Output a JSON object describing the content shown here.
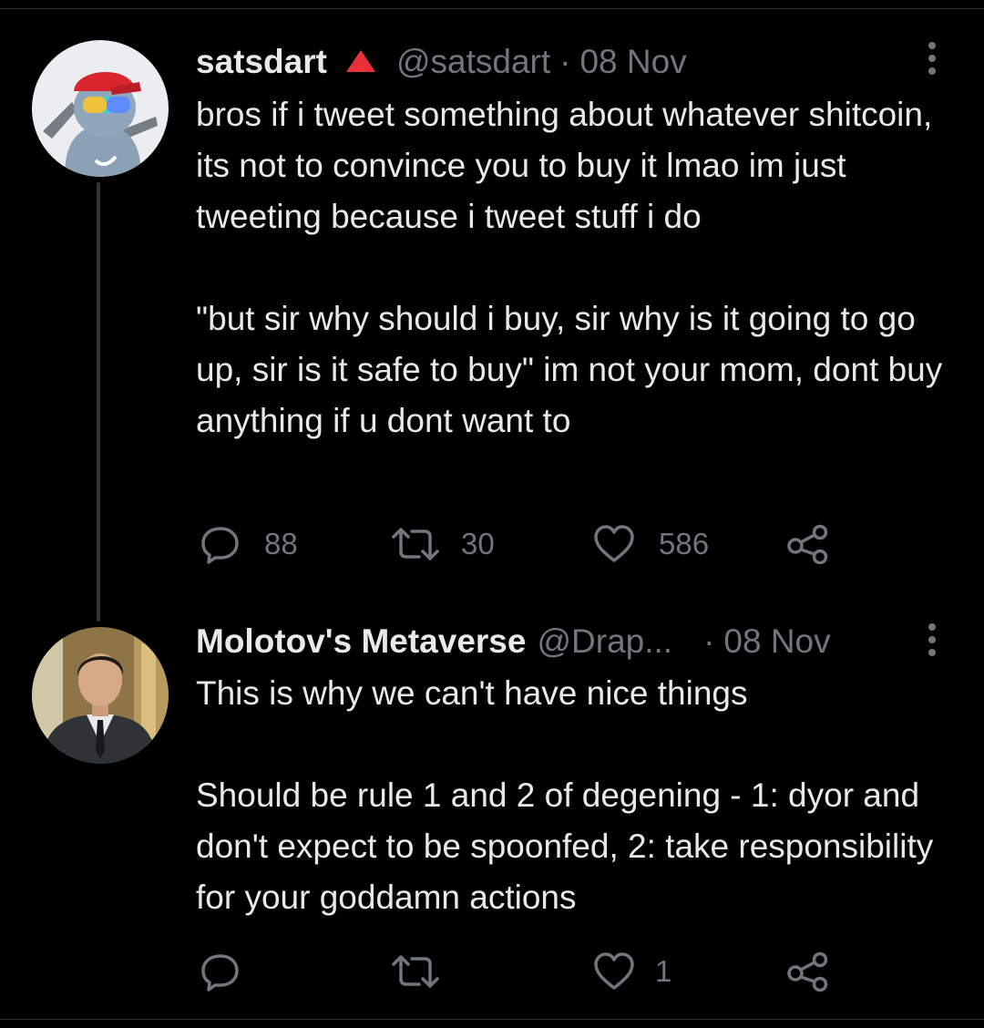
{
  "tweets": [
    {
      "name": "satsdart",
      "verified_icon": "red-triangle-icon",
      "handle": "@satsdart",
      "separator": "·",
      "date": "08 Nov",
      "paragraphs": [
        "bros if i tweet something about whatever shitcoin, its not to convince you to buy it lmao im just tweeting because i tweet stuff i do",
        "\"but sir why should i buy, sir why is it going to go up, sir is it safe to buy\" im not your mom, dont buy anything if u dont want to"
      ],
      "stats": {
        "replies": "88",
        "retweets": "30",
        "likes": "586"
      }
    },
    {
      "name": "Molotov's Metaverse",
      "handle": "@Drap...",
      "separator": "·",
      "date": "08 Nov",
      "paragraphs": [
        "This is why we can't have nice things",
        "Should be rule 1 and 2 of degening - 1: dyor and don't expect to be spoonfed, 2: take responsibility for your goddamn actions"
      ],
      "stats": {
        "replies": "",
        "retweets": "",
        "likes": "1"
      }
    }
  ],
  "colors": {
    "background": "#000000",
    "text": "#e7e9ea",
    "secondary": "#71767b",
    "thread_line": "#333639",
    "badge": "#e8313b"
  }
}
